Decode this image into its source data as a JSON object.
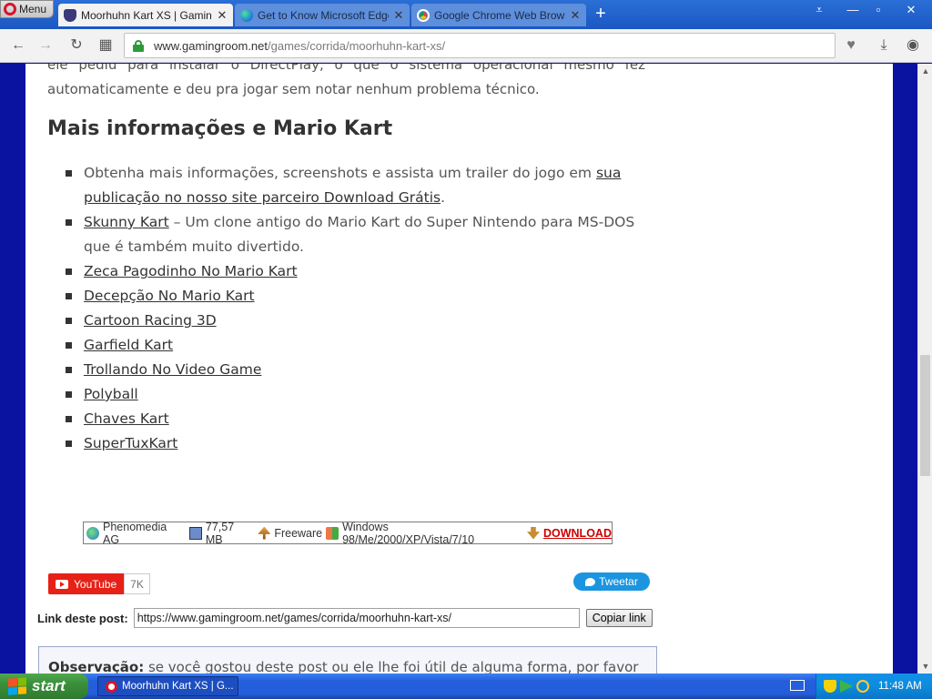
{
  "browser": {
    "menu_label": "Menu",
    "tabs": [
      {
        "title": "Moorhuhn Kart XS | GamingRoom",
        "icon": "shield-favicon",
        "active": true
      },
      {
        "title": "Get to Know Microsoft Edge",
        "icon": "edge-favicon",
        "active": false
      },
      {
        "title": "Google Chrome Web Browser",
        "icon": "chrome-favicon",
        "active": false
      }
    ],
    "new_tab": "+",
    "window_controls": {
      "tabs_menu": "⩡",
      "minimize": "—",
      "maximize": "▫",
      "close": "✕"
    },
    "nav": {
      "back": "←",
      "forward": "→",
      "reload": "↻",
      "speed_dial": "▦"
    },
    "address": {
      "host": "www.gamingroom.net",
      "path": "/games/corrida/moorhuhn-kart-xs/"
    },
    "toolbar_icons": {
      "heart": "♥",
      "download": "⤓",
      "account": "◉"
    }
  },
  "article": {
    "intro_line1": "ele pediu para instalar o DirectPlay, o que o sistema operacional mesmo fez",
    "intro_line2": "automaticamente e deu pra jogar sem notar nenhum problema técnico.",
    "heading": "Mais informações e Mario Kart",
    "items": {
      "item0_text": "Obtenha mais informações, screenshots e assista um trailer do jogo em ",
      "item0_link": "sua publicação no nosso site parceiro Download Grátis",
      "item0_tail": ".",
      "item1_link": "Skunny Kart",
      "item1_text": " – Um clone antigo do Mario Kart do Super Nintendo para MS-DOS que é também muito divertido.",
      "links": [
        "Zeca Pagodinho No Mario Kart",
        "Decepção No Mario Kart",
        "Cartoon Racing 3D",
        "Garfield Kart",
        "Trollando No Video Game",
        "Polyball",
        "Chaves Kart",
        "SuperTuxKart"
      ]
    }
  },
  "download_bar": {
    "developer": "Phenomedia AG",
    "size": "77,57 MB",
    "license": "Freeware",
    "os": "Windows 98/Me/2000/XP/Vista/7/10",
    "download_label": "DOWNLOAD"
  },
  "social": {
    "youtube_label": "YouTube",
    "youtube_count": "7K",
    "tweet_label": "Tweetar"
  },
  "post_link": {
    "label": "Link deste post:",
    "url": "https://www.gamingroom.net/games/corrida/moorhuhn-kart-xs/",
    "copy_button": "Copiar link"
  },
  "observation": {
    "bold": "Observação:",
    "text": " se você gostou deste post ou ele lhe foi útil de alguma forma, por favor"
  },
  "taskbar": {
    "start_label": "start",
    "task_title": "Moorhuhn Kart XS | G...",
    "clock": "11:48 AM"
  },
  "colors": {
    "page_background": "#0a12a0",
    "taskbar": "#245edb",
    "start_button": "#3b8f3b",
    "youtube_red": "#e62117",
    "twitter_blue": "#1b95e0",
    "download_red": "#cc0000"
  }
}
